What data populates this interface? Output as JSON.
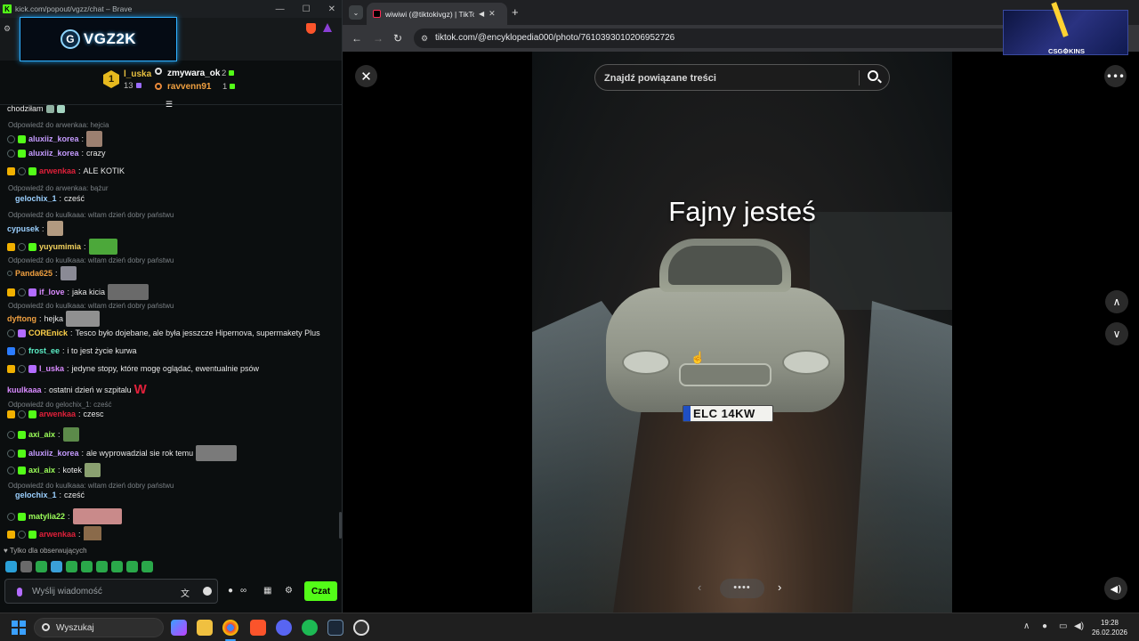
{
  "kick_window": {
    "title": "kick.com/popout/vgzz/chat – Brave",
    "banner_text": "VGZ2K",
    "leaderboard": {
      "rank": "1",
      "first": {
        "name": "l_uska",
        "count": "13"
      },
      "second": {
        "name": "zmywara_ok",
        "count": "2"
      },
      "third": {
        "name": "ravvenn91",
        "count": "1"
      }
    },
    "truncated_top": "chodziłam",
    "replies": [
      "Odpowiedź do arwenkaa: hejcia",
      "Odpowiedź do arwenkaa: bążur",
      "Odpowiedź do kuulkaaa: witam dzień dobry państwu",
      "Odpowiedź do kuulkaaa: witam dzień dobry państwu",
      "Odpowiedź do kuulkaaa: witam dzień dobry państwu",
      "Odpowiedź do gelochix_1: cześć",
      "Odpowiedź do kuulkaaa: witam dzień dobry państwu"
    ],
    "messages": [
      {
        "user": "aluxiiz_korea",
        "text": "",
        "color": "#c59bff"
      },
      {
        "user": "aluxiiz_korea",
        "text": "crazy",
        "color": "#c59bff"
      },
      {
        "user": "arwenkaa",
        "text": "ALE KOTIK",
        "color": "#e0203a"
      },
      {
        "user": "gelochix_1",
        "text": "cześć",
        "color": "#9bd0ff"
      },
      {
        "user": "cypusek",
        "text": "",
        "color": "#9bd0ff"
      },
      {
        "user": "yuyumimia",
        "text": "",
        "color": "#f4d35e"
      },
      {
        "user": "Panda625",
        "text": "",
        "color": "#f0a040"
      },
      {
        "user": "if_love",
        "text": "jaka kicia",
        "color": "#d98bff"
      },
      {
        "user": "dyftong",
        "text": "hejka",
        "color": "#f0a040"
      },
      {
        "user": "COREnick",
        "text": "Tesco było dojebane, ale była jesszcze Hipernova, supermakety Plus",
        "color": "#ffd24a"
      },
      {
        "user": "frost_ee",
        "text": "i to jest życie kurwa",
        "color": "#5cf0c8"
      },
      {
        "user": "l_uska",
        "text": "jedyne stopy, które mogę oglądać, ewentualnie psów",
        "color": "#d98bff"
      },
      {
        "user": "kuulkaaa",
        "text": "ostatni dzień w szpitalu",
        "color": "#d98bff"
      },
      {
        "user": "arwenkaa",
        "text": "czesc",
        "color": "#e0203a"
      },
      {
        "user": "axi_aix",
        "text": "",
        "color": "#9cff5a"
      },
      {
        "user": "aluxiiz_korea",
        "text": "ale wyprowadzial sie rok temu",
        "color": "#c59bff"
      },
      {
        "user": "axi_aix",
        "text": "kotek",
        "color": "#9cff5a"
      },
      {
        "user": "gelochix_1",
        "text": "cześć",
        "color": "#9bd0ff"
      },
      {
        "user": "matylia22",
        "text": "",
        "color": "#9cff5a"
      },
      {
        "user": "arwenkaa",
        "text": "",
        "color": "#e0203a"
      }
    ],
    "followers_only": "Tylko dla obserwujących",
    "input_placeholder": "Wyślij wiadomość",
    "send_label": "Czat",
    "accent": "#53fc18"
  },
  "chrome_window": {
    "tab_title": "wiwiwi (@tiktokivgz) | TikTok",
    "url": "tiktok.com/@encyklopedia000/photo/7610393010206952726",
    "search_placeholder": "Znajdź powiązane treści",
    "photo_caption": "Fajny jesteś",
    "plate_text": "ELC 14KW"
  },
  "overlay": {
    "text": "CSG⚙KINS"
  },
  "taskbar": {
    "search_label": "Wyszukaj",
    "time": "19:28",
    "date": "26.02.2026"
  }
}
